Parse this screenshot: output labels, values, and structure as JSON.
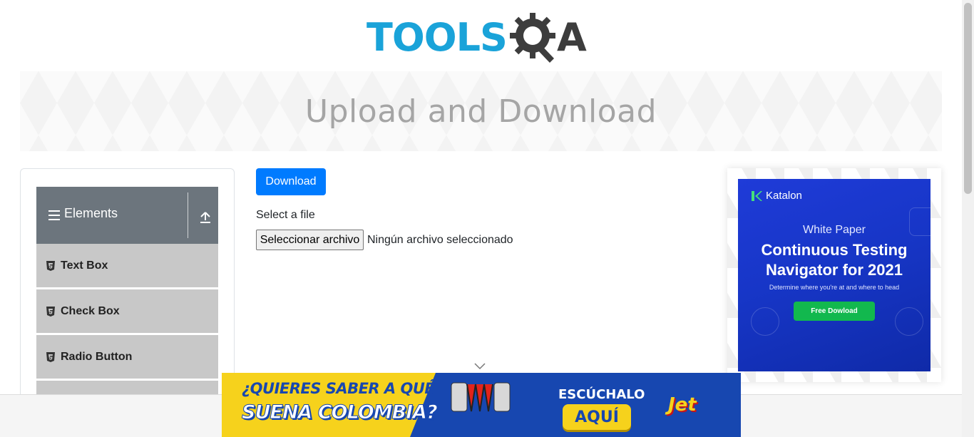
{
  "header": {
    "logo_text": "TOOLS",
    "logo_suffix": "A"
  },
  "banner": {
    "title": "Upload and Download"
  },
  "sidebar": {
    "group_title": "Elements",
    "items": [
      {
        "label": "Text Box"
      },
      {
        "label": "Check Box"
      },
      {
        "label": "Radio Button"
      }
    ]
  },
  "main": {
    "download_label": "Download",
    "select_label": "Select a file",
    "file_button_label": "Seleccionar archivo",
    "file_status": "Ningún archivo seleccionado"
  },
  "side_ad": {
    "brand": "Katalon",
    "kicker": "White Paper",
    "headline_line1": "Continuous Testing",
    "headline_line2": "Navigator for 2021",
    "subtext": "Determine where you're at and where to head",
    "cta": "Free Dowload"
  },
  "bottom_ad": {
    "line1": "¿QUIERES SABER A QUÉ",
    "line2": "SUENA COLOMBIA?",
    "listen": "ESCÚCHALO",
    "here": "AQUÍ",
    "brand": "Jet"
  },
  "colors": {
    "primary": "#007bff",
    "logo_blue": "#1aa3d9",
    "sidebar_header": "#6c757d",
    "menu_item": "#c8c8c8",
    "ad_blue": "#1f3bd8",
    "cta_green": "#12b84e"
  },
  "icons": [
    "hamburger-icon",
    "upload-arrow-icon",
    "html5-icon",
    "gear-icon",
    "chevron-down-icon",
    "katalon-logo-icon",
    "accordion-icon"
  ]
}
